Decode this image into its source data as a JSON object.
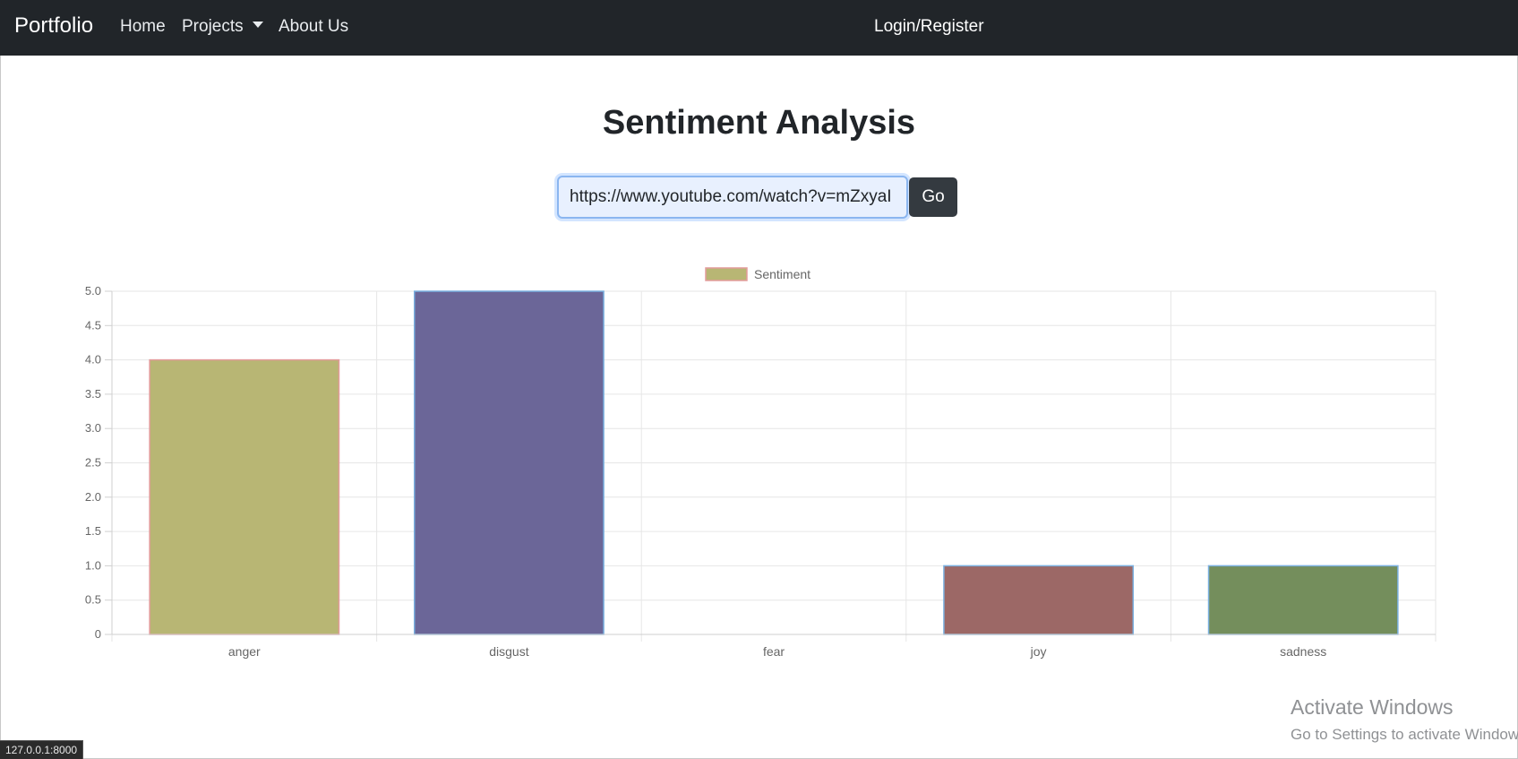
{
  "navbar": {
    "brand": "Portfolio",
    "links": [
      {
        "label": "Home"
      },
      {
        "label": "Projects",
        "dropdown": true
      },
      {
        "label": "About Us"
      }
    ],
    "login_label": "Login/Register"
  },
  "main": {
    "title": "Sentiment Analysis",
    "url_input_value": "https://www.youtube.com/watch?v=mZxyaI",
    "go_label": "Go"
  },
  "chart_data": {
    "type": "bar",
    "categories": [
      "anger",
      "disgust",
      "fear",
      "joy",
      "sadness"
    ],
    "series": [
      {
        "name": "Sentiment",
        "values": [
          4,
          5,
          0,
          1,
          1
        ]
      }
    ],
    "bar_colors": [
      "#b8b674",
      "#6b6698",
      "#9e9e9e",
      "#9c6866",
      "#748e5c"
    ],
    "bar_border_colors": [
      "#e39b9b",
      "#7ab0e0",
      "#7ab0e0",
      "#7ab0e0",
      "#7ab0e0"
    ],
    "legend": {
      "label": "Sentiment",
      "position": "top",
      "swatch_color": "#b8b674",
      "swatch_border": "#e39b9b"
    },
    "ylim": [
      0,
      5
    ],
    "yticks": [
      "0",
      "0.5",
      "1.0",
      "1.5",
      "2.0",
      "2.5",
      "3.0",
      "3.5",
      "4.0",
      "4.5",
      "5.0"
    ],
    "grid": true,
    "title": "",
    "xlabel": "",
    "ylabel": ""
  },
  "system": {
    "watermark_line1": "Activate Windows",
    "watermark_line2": "Go to Settings to activate Windows.",
    "status_url": "127.0.0.1:8000"
  }
}
